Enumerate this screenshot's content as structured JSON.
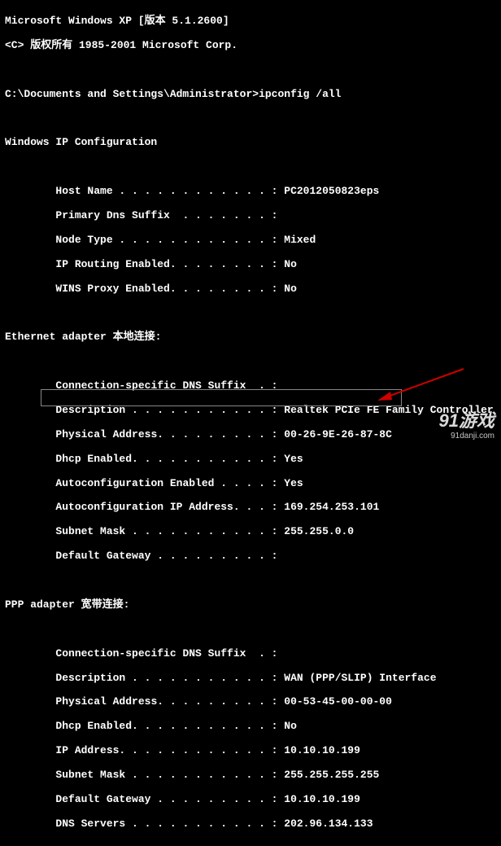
{
  "header": {
    "line1": "Microsoft Windows XP [版本 5.1.2600]",
    "line2": "<C> 版权所有 1985-2001 Microsoft Corp."
  },
  "prompt": {
    "path": "C:\\Documents and Settings\\Administrator>",
    "command": "ipconfig /all"
  },
  "section_ipconfig_title": "Windows IP Configuration",
  "ipconfig": {
    "host_name_label": "Host Name . . . . . . . . . . . . :",
    "host_name": "PC2012050823eps",
    "primary_dns_label": "Primary Dns Suffix  . . . . . . . :",
    "primary_dns": "",
    "node_type_label": "Node Type . . . . . . . . . . . . :",
    "node_type": "Mixed",
    "ip_routing_label": "IP Routing Enabled. . . . . . . . :",
    "ip_routing": "No",
    "wins_proxy_label": "WINS Proxy Enabled. . . . . . . . :",
    "wins_proxy": "No"
  },
  "ethernet_title_prefix": "Ethernet adapter ",
  "ethernet_title_name": "本地连接:",
  "ethernet": {
    "dns_suffix_label": "Connection-specific DNS Suffix  . :",
    "dns_suffix": "",
    "desc_label": "Description . . . . . . . . . . . :",
    "desc": "Realtek PCIe FE Family Controller",
    "phys_label": "Physical Address. . . . . . . . . :",
    "phys": "00-26-9E-26-87-8C",
    "dhcp_label": "Dhcp Enabled. . . . . . . . . . . :",
    "dhcp": "Yes",
    "autoconf_label": "Autoconfiguration Enabled . . . . :",
    "autoconf": "Yes",
    "autoip_label": "Autoconfiguration IP Address. . . :",
    "autoip": "169.254.253.101",
    "subnet_label": "Subnet Mask . . . . . . . . . . . :",
    "subnet": "255.255.0.0",
    "gateway_label": "Default Gateway . . . . . . . . . :",
    "gateway": ""
  },
  "ppp_title_prefix": "PPP adapter ",
  "ppp_title_name": "宽带连接:",
  "ppp": {
    "dns_suffix_label": "Connection-specific DNS Suffix  . :",
    "dns_suffix": "",
    "desc_label": "Description . . . . . . . . . . . :",
    "desc": "WAN (PPP/SLIP) Interface",
    "phys_label": "Physical Address. . . . . . . . . :",
    "phys": "00-53-45-00-00-00",
    "dhcp_label": "Dhcp Enabled. . . . . . . . . . . :",
    "dhcp": "No",
    "ip_label": "IP Address. . . . . . . . . . . . :",
    "ip": "10.10.10.199",
    "subnet_label": "Subnet Mask . . . . . . . . . . . :",
    "subnet": "255.255.255.255",
    "gateway_label": "Default Gateway . . . . . . . . . :",
    "gateway": "10.10.10.199",
    "dns_label": "DNS Servers . . . . . . . . . . . :",
    "dns": "202.96.134.133"
  },
  "watermark": {
    "brand": "91游戏",
    "url": "91danji.com"
  }
}
